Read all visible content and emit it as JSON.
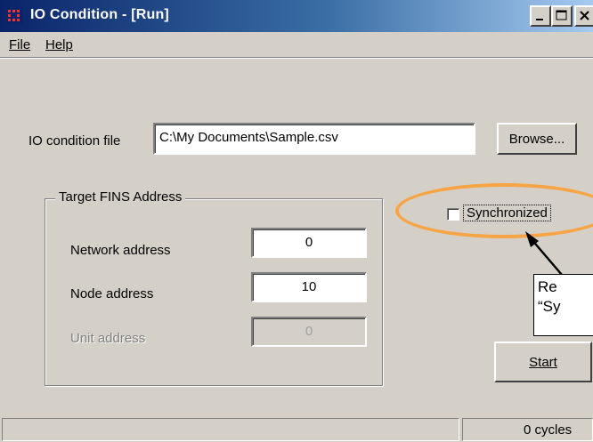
{
  "window": {
    "title": "IO Condition - [Run]",
    "icon": "app-icon"
  },
  "menu": {
    "file_label": "File",
    "help_label": "Help"
  },
  "io_condition": {
    "label": "IO condition file",
    "value": "C:\\My Documents\\Sample.csv",
    "browse_label": "Browse..."
  },
  "target_fins": {
    "group_title": "Target FINS Address",
    "network_label": "Network address",
    "network_value": "0",
    "node_label": "Node address",
    "node_value": "10",
    "unit_label": "Unit address",
    "unit_value": "0"
  },
  "sync": {
    "label": "Synchronized",
    "checked": false
  },
  "start_label": "Start",
  "status": {
    "main_text": "",
    "cycles_text": "0 cycles"
  },
  "callout": {
    "line1": "Re",
    "line2": "“Sy"
  },
  "colors": {
    "titlebar_start": "#0a246a",
    "titlebar_end": "#a6caf0",
    "highlight": "#f7a445",
    "face": "#d4d0c8"
  }
}
